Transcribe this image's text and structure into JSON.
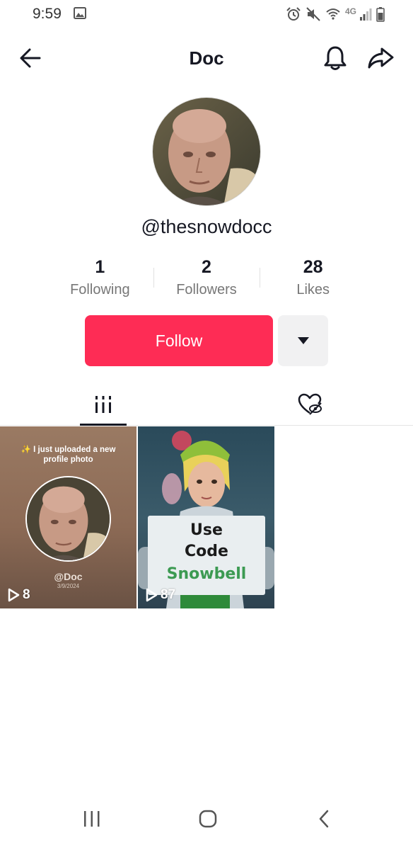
{
  "status_bar": {
    "time": "9:59",
    "network": "4G"
  },
  "header": {
    "title": "Doc"
  },
  "profile": {
    "username": "@thesnowdocc"
  },
  "stats": [
    {
      "value": "1",
      "label": "Following"
    },
    {
      "value": "2",
      "label": "Followers"
    },
    {
      "value": "28",
      "label": "Likes"
    }
  ],
  "actions": {
    "follow_label": "Follow"
  },
  "tabs": {
    "active": "videos",
    "items": [
      "videos-grid-icon",
      "liked-heart-icon"
    ]
  },
  "videos": [
    {
      "views": "8",
      "caption": "✨ I just uploaded a new profile photo",
      "handle": "@Doc",
      "date": "3/9/2024"
    },
    {
      "views": "87",
      "sign_lines": [
        "Use",
        "Code",
        "Snowbell"
      ]
    }
  ],
  "colors": {
    "accent": "#fe2c55",
    "text": "#161823",
    "muted": "#777777"
  }
}
